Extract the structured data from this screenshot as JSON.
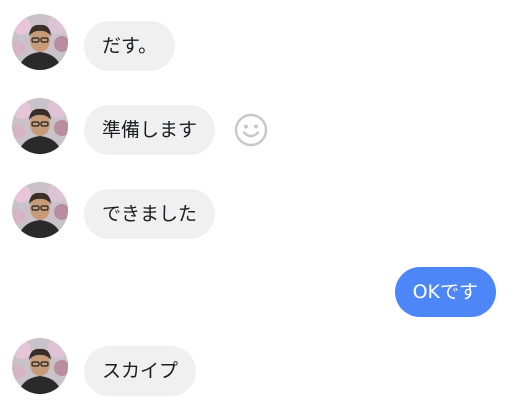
{
  "messages": [
    {
      "sender": "them",
      "text": "だす。"
    },
    {
      "sender": "them",
      "text": "準備します",
      "reaction_icon": "smiley-icon"
    },
    {
      "sender": "them",
      "text": "できました"
    },
    {
      "sender": "me",
      "text": "OKです"
    },
    {
      "sender": "them",
      "text": "スカイプ"
    }
  ],
  "colors": {
    "incoming_bubble": "#f0f0f0",
    "outgoing_bubble": "#4d86f7",
    "incoming_text": "#1c1e21",
    "outgoing_text": "#ffffff"
  }
}
